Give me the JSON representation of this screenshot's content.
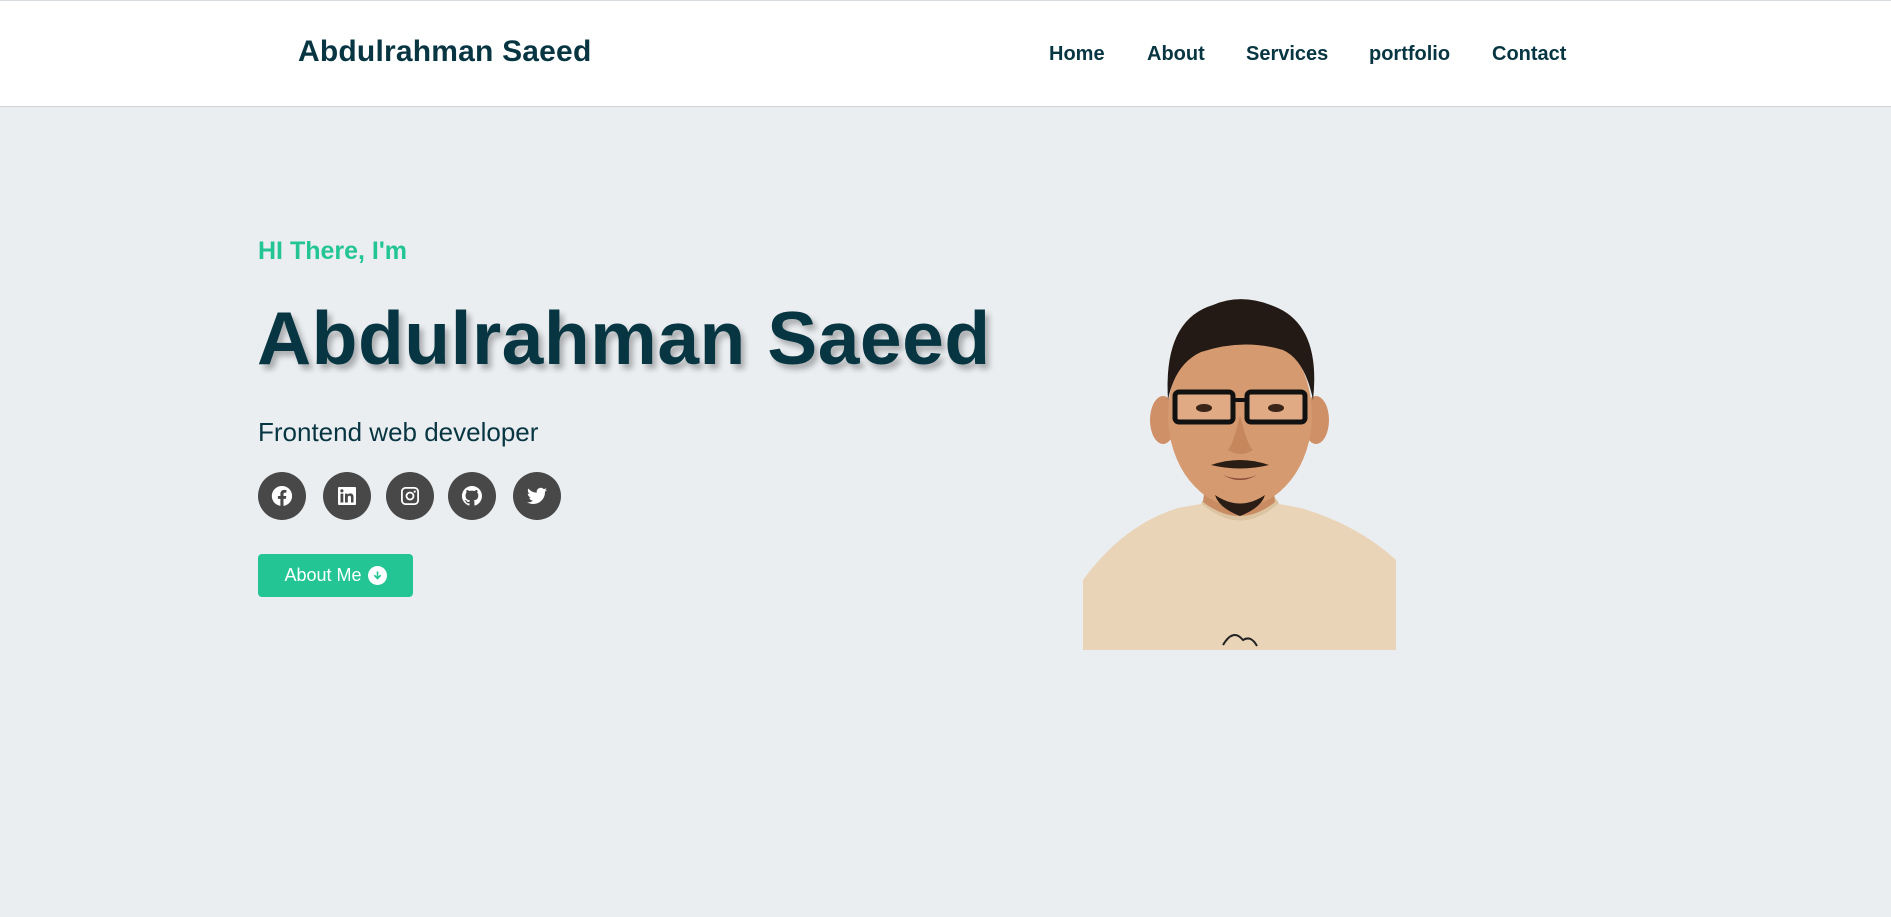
{
  "navbar": {
    "brand": "Abdulrahman Saeed",
    "links": [
      "Home",
      "About",
      "Services",
      "portfolio",
      "Contact"
    ]
  },
  "hero": {
    "greeting": "HI There, I'm",
    "name": "Abdulrahman Saeed",
    "role": "Frontend web developer",
    "button_label": "About Me",
    "button_icon": "arrow-circle-down-icon",
    "socials": [
      "facebook-icon",
      "linkedin-icon",
      "instagram-icon",
      "github-icon",
      "twitter-icon"
    ]
  },
  "colors": {
    "accent": "#22c593",
    "heading": "#073642",
    "background": "#ebeef1",
    "social_bg": "#484848"
  }
}
